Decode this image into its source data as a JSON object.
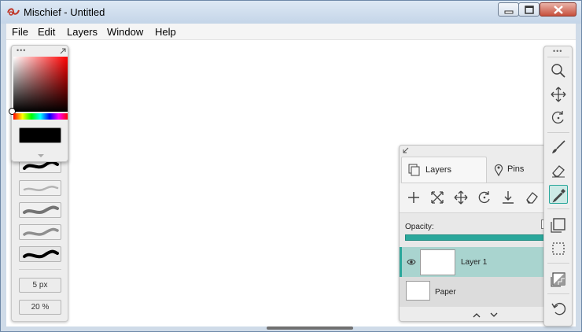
{
  "window": {
    "title": "Mischief - Untitled"
  },
  "menu": [
    "File",
    "Edit",
    "Layers",
    "Window",
    "Help"
  ],
  "brush_panel": {
    "size_label": "5 px",
    "opacity_label": "20 %"
  },
  "color": {
    "current": "#000000"
  },
  "layers_panel": {
    "tabs": [
      {
        "label": "Layers",
        "icon": "layers-icon"
      },
      {
        "label": "Pins",
        "icon": "pin-icon"
      }
    ],
    "tools": [
      "add-layer-icon",
      "transform-icon",
      "move-icon",
      "rotate-icon",
      "merge-down-icon",
      "erase-icon"
    ],
    "opacity_label": "Opacity:",
    "layers": [
      {
        "name": "Layer 1",
        "selected": true,
        "visible": true
      },
      {
        "name": "Paper",
        "selected": false
      }
    ]
  },
  "toolbar": {
    "tools": [
      "zoom-icon",
      "pan-icon",
      "rotate-canvas-icon",
      "brush-icon",
      "eraser-icon",
      "eyedropper-icon",
      "shape-icon",
      "selection-icon",
      "transparency-icon",
      "undo-icon"
    ],
    "selected": "eyedropper-icon"
  },
  "colors": {
    "accent": "#2aa79b",
    "selected_row": "#a9d4cf"
  }
}
